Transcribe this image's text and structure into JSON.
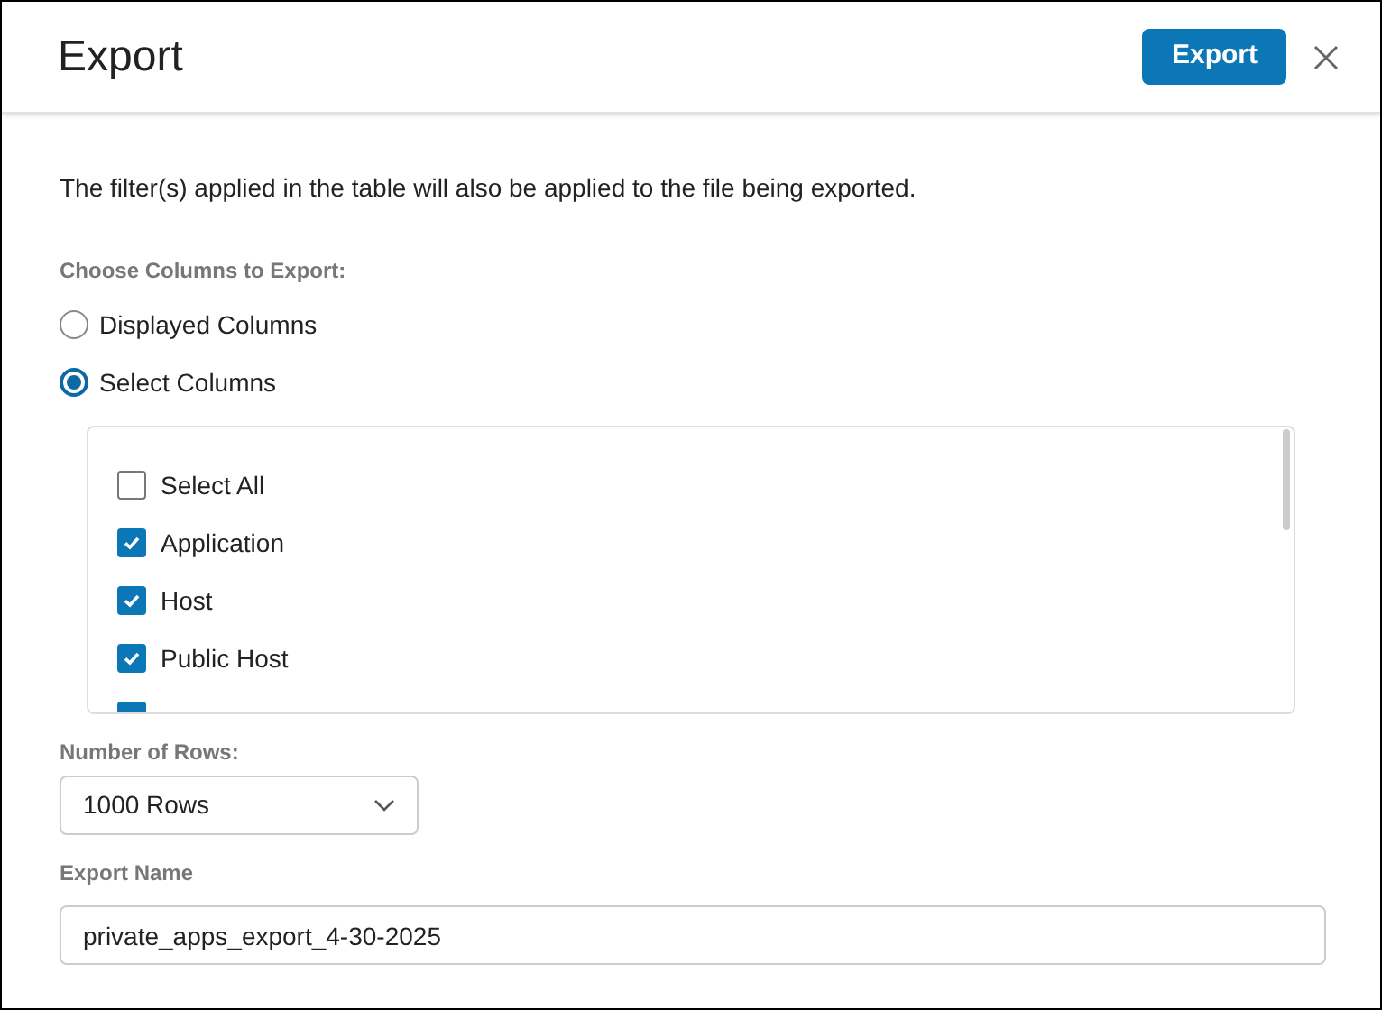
{
  "dialog": {
    "title": "Export",
    "primary_button": "Export"
  },
  "notice": "The filter(s) applied in the table will also be applied to the file being exported.",
  "columns_choice": {
    "label": "Choose Columns to Export:",
    "options": [
      {
        "label": "Displayed Columns",
        "selected": false
      },
      {
        "label": "Select Columns",
        "selected": true
      }
    ]
  },
  "column_list": [
    {
      "label": "Select All",
      "checked": false
    },
    {
      "label": "Application",
      "checked": true
    },
    {
      "label": "Host",
      "checked": true
    },
    {
      "label": "Public Host",
      "checked": true
    },
    {
      "checked": true
    }
  ],
  "rows": {
    "label": "Number of Rows:",
    "value": "1000 Rows"
  },
  "export_name": {
    "label": "Export Name",
    "value": "private_apps_export_4-30-2025"
  }
}
